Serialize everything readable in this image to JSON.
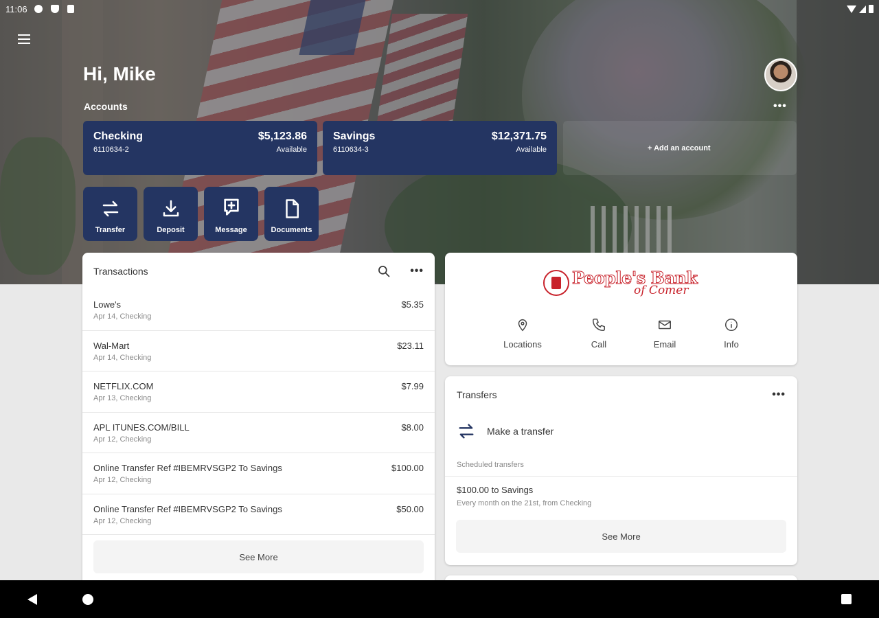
{
  "status_bar": {
    "time": "11:06"
  },
  "header": {
    "greeting": "Hi, Mike",
    "accounts_label": "Accounts",
    "more": "•••"
  },
  "accounts": [
    {
      "name": "Checking",
      "number": "6110634-2",
      "balance": "$5,123.86",
      "balance_label": "Available"
    },
    {
      "name": "Savings",
      "number": "6110634-3",
      "balance": "$12,371.75",
      "balance_label": "Available"
    }
  ],
  "add_account": "+ Add an account",
  "quick_actions": [
    {
      "label": "Transfer",
      "icon": "transfer-icon"
    },
    {
      "label": "Deposit",
      "icon": "deposit-icon"
    },
    {
      "label": "Message",
      "icon": "message-icon"
    },
    {
      "label": "Documents",
      "icon": "document-icon"
    }
  ],
  "transactions": {
    "title": "Transactions",
    "more": "•••",
    "items": [
      {
        "merchant": "Lowe's",
        "sub": "Apr 14, Checking",
        "amount": "$5.35"
      },
      {
        "merchant": "Wal-Mart",
        "sub": "Apr 14, Checking",
        "amount": "$23.11"
      },
      {
        "merchant": "NETFLIX.COM",
        "sub": "Apr 13, Checking",
        "amount": "$7.99"
      },
      {
        "merchant": "APL ITUNES.COM/BILL",
        "sub": "Apr 12, Checking",
        "amount": "$8.00"
      },
      {
        "merchant": "Online Transfer Ref #IBEMRVSGP2 To Savings",
        "sub": "Apr 12, Checking",
        "amount": "$100.00"
      },
      {
        "merchant": "Online Transfer Ref #IBEMRVSGP2 To Savings",
        "sub": "Apr 12, Checking",
        "amount": "$50.00"
      }
    ],
    "see_more": "See More"
  },
  "bank": {
    "logo_main": "People's Bank",
    "logo_sub": "of Comer",
    "actions": [
      {
        "label": "Locations",
        "icon": "location-pin-icon"
      },
      {
        "label": "Call",
        "icon": "phone-icon"
      },
      {
        "label": "Email",
        "icon": "mail-icon"
      },
      {
        "label": "Info",
        "icon": "info-icon"
      }
    ]
  },
  "transfers": {
    "title": "Transfers",
    "more": "•••",
    "make_transfer": "Make a transfer",
    "scheduled_label": "Scheduled transfers",
    "scheduled": [
      {
        "main": "$100.00 to Savings",
        "sub": "Every month on the 21st, from Checking"
      }
    ],
    "see_more": "See More"
  },
  "colors": {
    "navy": "#243562",
    "brand_red": "#c8222b"
  }
}
